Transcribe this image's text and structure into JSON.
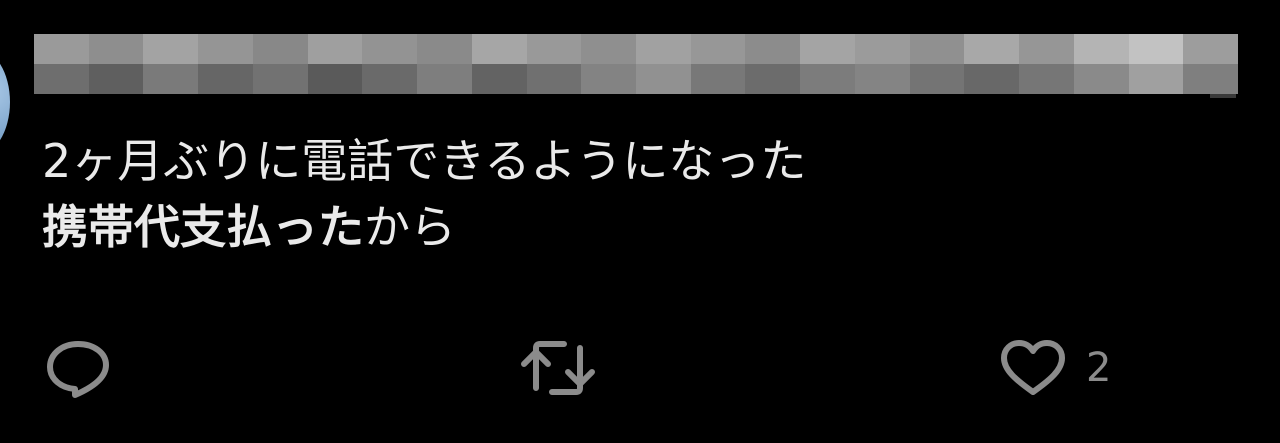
{
  "tweet": {
    "text_line1": "2ヶ月ぶりに電話できるようになった",
    "text_line2_bold": "携帯代支払った",
    "text_line2_rest": "から"
  },
  "actions": {
    "reply_icon": "reply-icon",
    "retweet_icon": "retweet-icon",
    "like_icon": "heart-icon",
    "like_count": "2"
  },
  "colors": {
    "background": "#000000",
    "text": "#eaeaea",
    "icon": "#8b8b8b"
  }
}
